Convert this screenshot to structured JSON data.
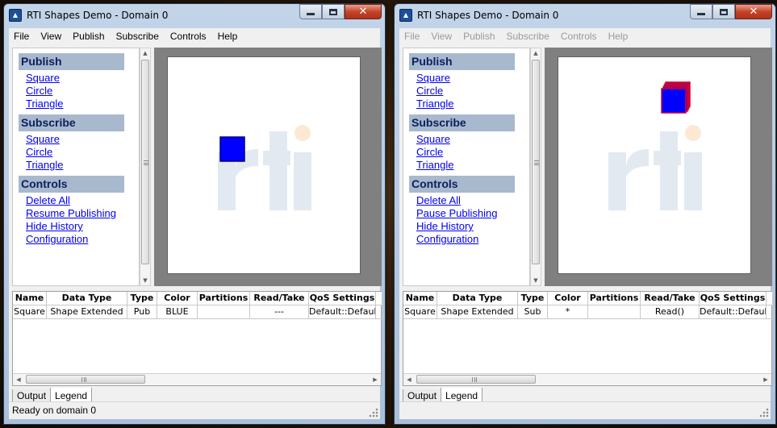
{
  "windows": [
    {
      "title": "RTI Shapes Demo - Domain 0",
      "menu_enabled": true,
      "menu": [
        "File",
        "View",
        "Publish",
        "Subscribe",
        "Controls",
        "Help"
      ],
      "sidebar": {
        "publish": {
          "title": "Publish",
          "links": [
            "Square",
            "Circle",
            "Triangle"
          ]
        },
        "subscribe": {
          "title": "Subscribe",
          "links": [
            "Square",
            "Circle",
            "Triangle"
          ]
        },
        "controls": {
          "title": "Controls",
          "links": [
            "Delete All",
            "Resume Publishing",
            "Hide History",
            "Configuration"
          ]
        }
      },
      "canvas": {
        "logo": "rti",
        "shapes": [
          {
            "type": "square",
            "color": "#0000ff",
            "outline": "#000080",
            "history": false
          }
        ]
      },
      "table": {
        "headers": [
          "Name",
          "Data Type",
          "Type",
          "Color",
          "Partitions",
          "Read/Take",
          "QoS Settings"
        ],
        "rows": [
          [
            "Square",
            "Shape Extended",
            "Pub",
            "BLUE",
            "",
            "---",
            "Default::Default"
          ]
        ]
      },
      "tabs": [
        "Output",
        "Legend"
      ],
      "active_tab": "Legend",
      "status": "Ready on domain 0"
    },
    {
      "title": "RTI Shapes Demo - Domain 0",
      "menu_enabled": false,
      "menu": [
        "File",
        "View",
        "Publish",
        "Subscribe",
        "Controls",
        "Help"
      ],
      "sidebar": {
        "publish": {
          "title": "Publish",
          "links": [
            "Square",
            "Circle",
            "Triangle"
          ]
        },
        "subscribe": {
          "title": "Subscribe",
          "links": [
            "Square",
            "Circle",
            "Triangle"
          ]
        },
        "controls": {
          "title": "Controls",
          "links": [
            "Delete All",
            "Pause Publishing",
            "Hide History",
            "Configuration"
          ]
        }
      },
      "canvas": {
        "logo": "rti",
        "shapes": [
          {
            "type": "square",
            "color": "#0000ff",
            "outline": "#cc0033",
            "history": true
          }
        ]
      },
      "table": {
        "headers": [
          "Name",
          "Data Type",
          "Type",
          "Color",
          "Partitions",
          "Read/Take",
          "QoS Settings"
        ],
        "rows": [
          [
            "Square",
            "Shape Extended",
            "Sub",
            "*",
            "",
            "Read()",
            "Default::Default"
          ]
        ]
      },
      "tabs": [
        "Output",
        "Legend"
      ],
      "active_tab": "Legend",
      "status": ""
    }
  ],
  "colors": {
    "link": "#0000ee",
    "section_header_bg": "#a8b9ce",
    "section_header_text": "#0b1f5e",
    "logo_gray": "#e3e9f1",
    "logo_dot": "#fde9d3"
  }
}
